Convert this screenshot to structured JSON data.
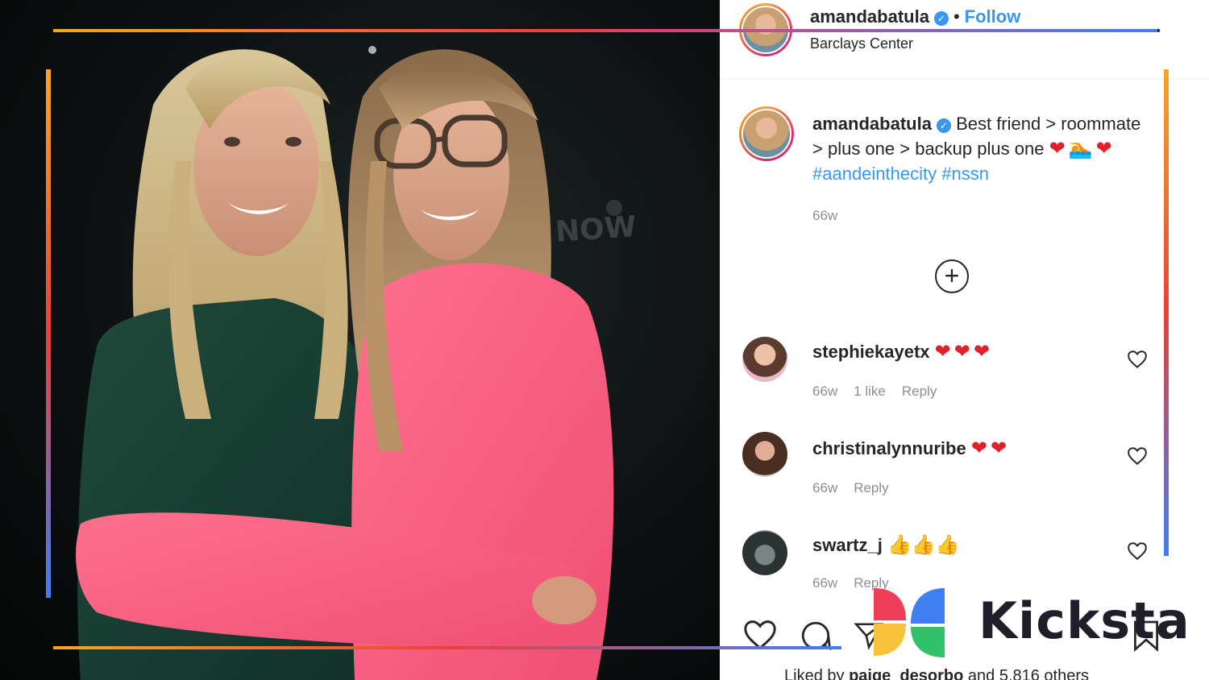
{
  "post": {
    "username": "amandabatula",
    "verified_mark": "✓",
    "dot": "•",
    "follow_label": "Follow",
    "location": "Barclays Center",
    "caption_user": "amandabatula",
    "caption_text": "Best friend > roommate > plus one > backup plus one",
    "caption_emoji": "❤🏊❤",
    "caption_tags": "#aandeinthecity #nssn",
    "time": "66w",
    "load_more_icon": "+"
  },
  "comments": [
    {
      "username": "stephiekayetx",
      "emoji": "❤❤❤",
      "time": "66w",
      "likes": "1 like",
      "reply": "Reply"
    },
    {
      "username": "christinalynnuribe",
      "emoji": "❤❤",
      "time": "66w",
      "reply": "Reply"
    },
    {
      "username": "swartz_j",
      "emoji": "👍👍👍",
      "time": "66w",
      "reply": "Reply"
    }
  ],
  "liked_by": {
    "prefix": "Liked by",
    "user": "paige_desorbo",
    "suffix": "and 5,816 others"
  },
  "brand": {
    "name": "Kicksta"
  },
  "photo": {
    "background_sign_text": "NOW"
  },
  "colors": {
    "accent_blue": "#3897f0",
    "heart_red": "#e0202b",
    "frame_orange": "#f6a623",
    "frame_red": "#e8413a",
    "frame_blue": "#3f7ff0"
  }
}
